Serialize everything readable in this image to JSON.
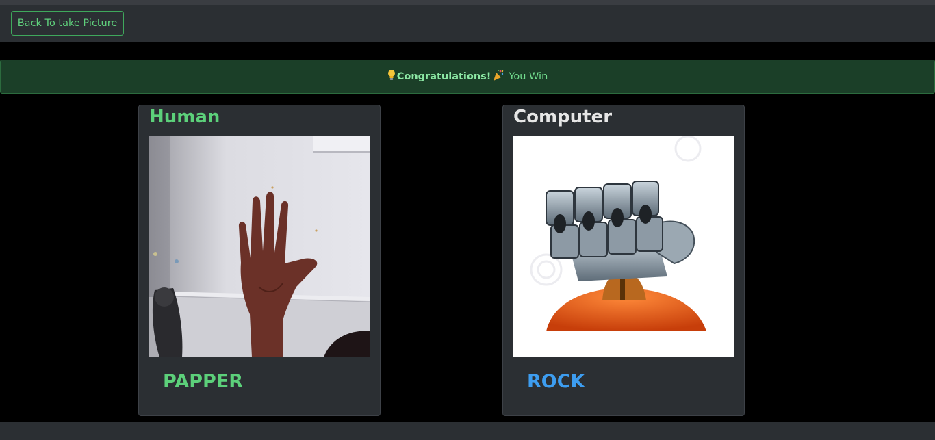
{
  "toolbar": {
    "back_label": "Back To take Picture"
  },
  "alert": {
    "icon_left": "lightbulb-icon",
    "title": "Congratulations!",
    "icon_right": "party-popper-icon",
    "message": "You Win"
  },
  "human": {
    "title": "Human",
    "photo_icon": "open-hand-photo",
    "choice": "PAPPER"
  },
  "computer": {
    "title": "Computer",
    "photo_icon": "robot-fist-rock-image",
    "choice": "ROCK"
  },
  "colors": {
    "success": "#5cd07a",
    "accent_blue": "#3d9df0",
    "alert_bg": "#1b3f28",
    "card_bg": "#2b2f33",
    "page_bg": "#000000"
  }
}
